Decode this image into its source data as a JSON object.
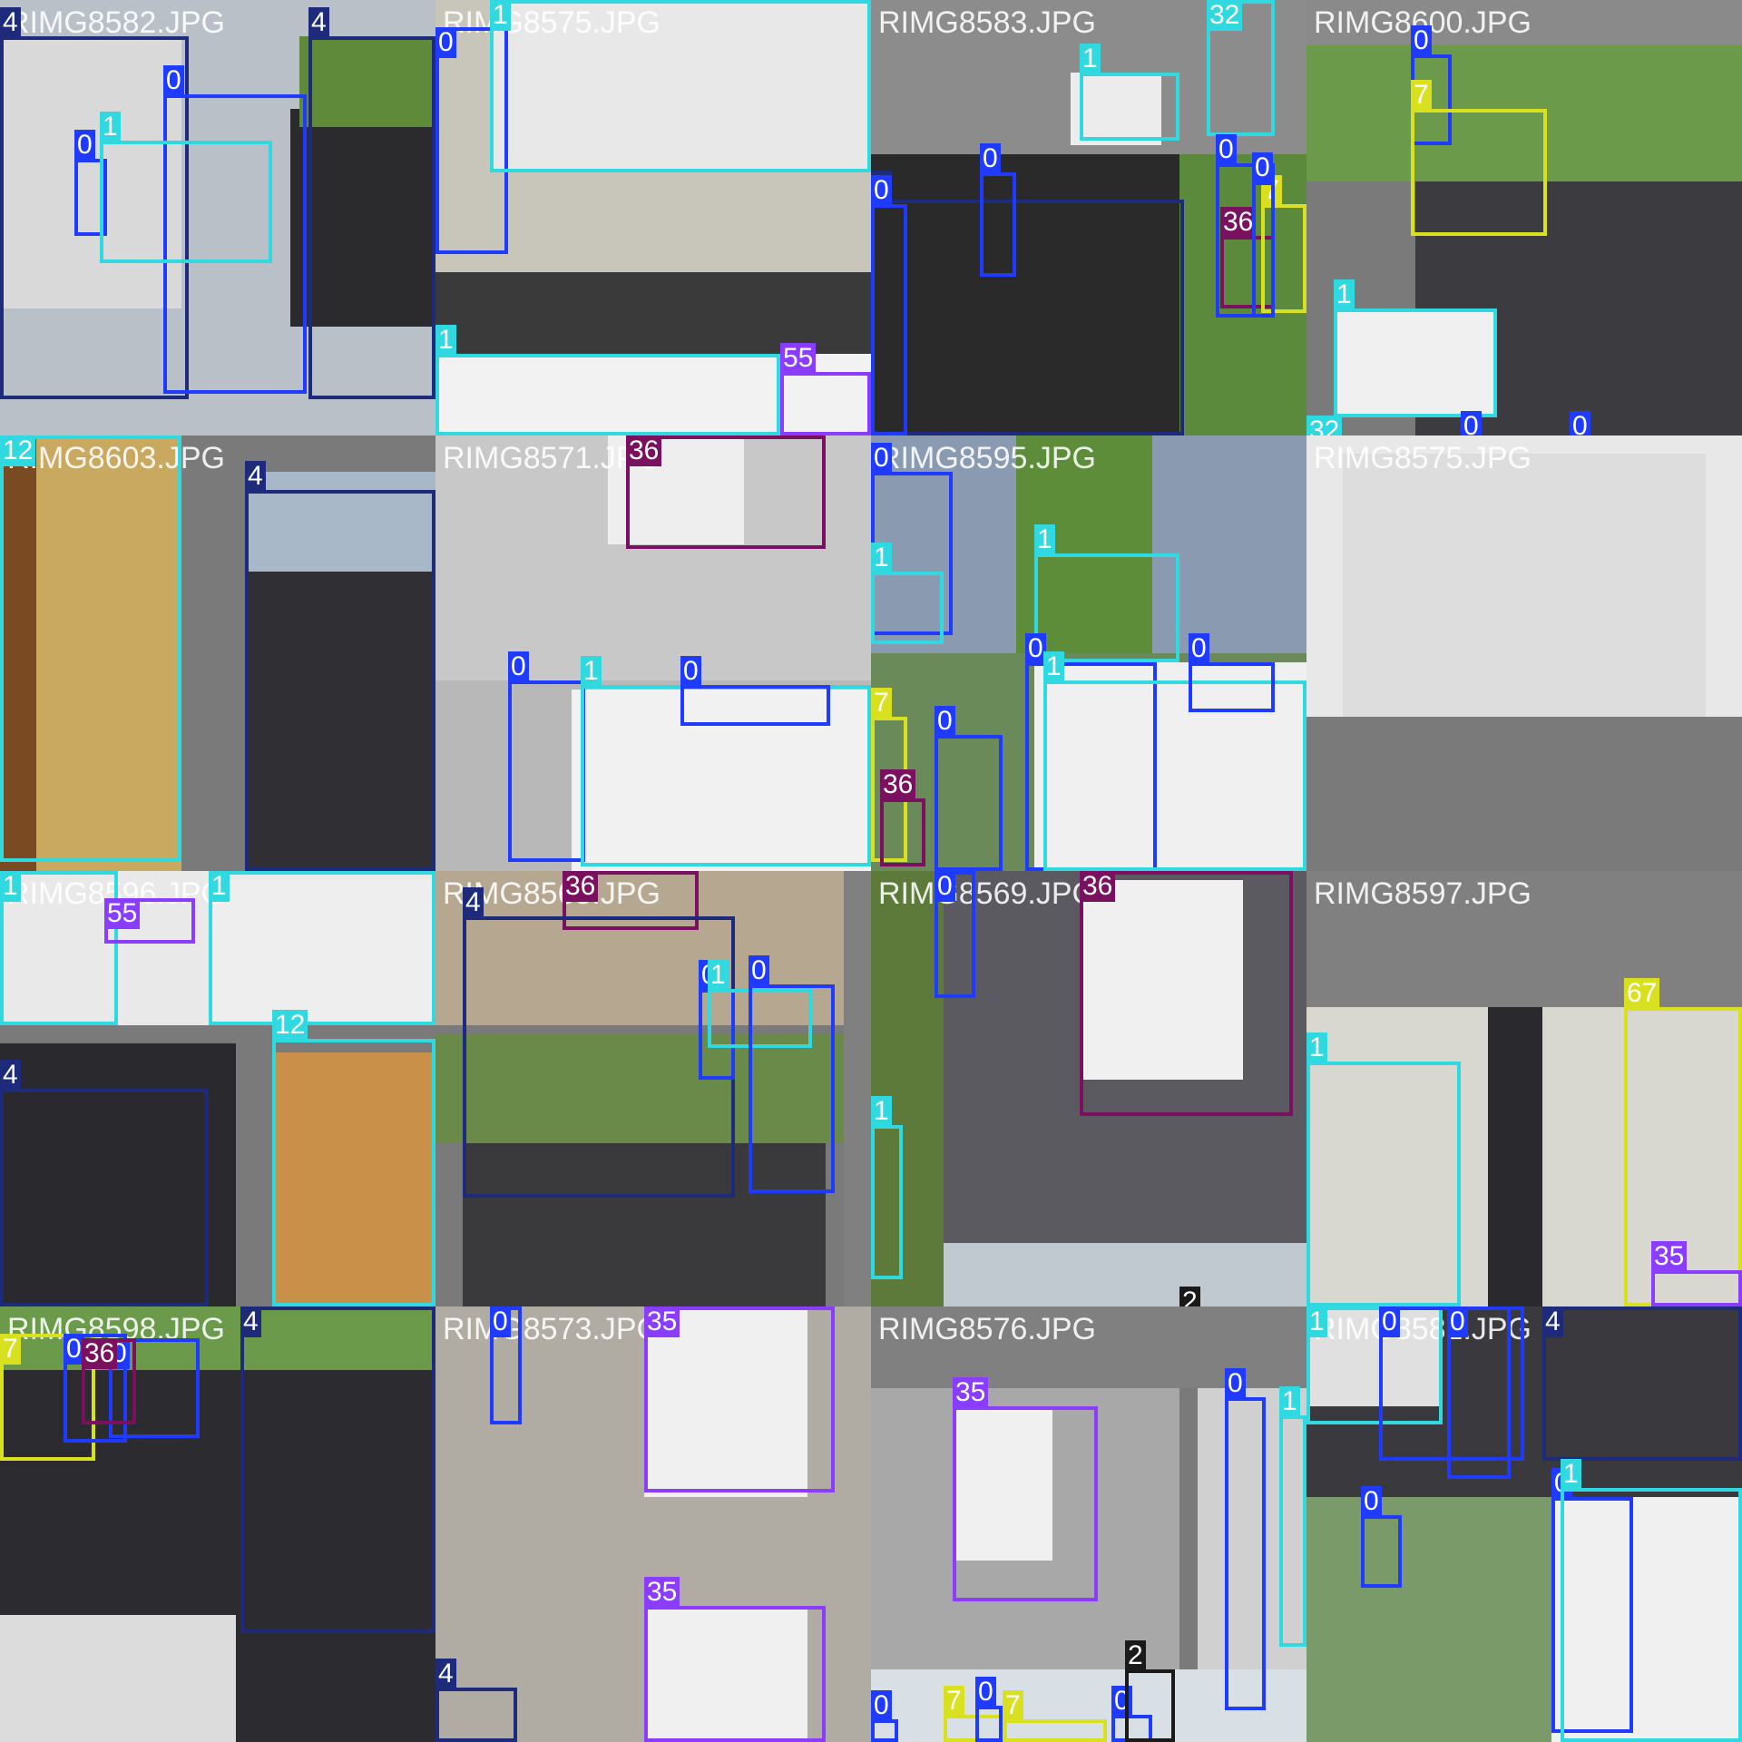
{
  "mosaic": {
    "class_colors": {
      "0": "#1f3bff",
      "1": "#30d8e0",
      "2": "#1a1a1a",
      "4": "#1e2a7a",
      "7": "#d8e020",
      "12": "#30d8e0",
      "32": "#30d8e0",
      "35": "#8a3cff",
      "36": "#7a1060",
      "55": "#8a3cff",
      "67": "#d8e020"
    },
    "tiles": [
      {
        "id": "t0",
        "label": "RIMG8582.JPG"
      },
      {
        "id": "t1",
        "label": "RIMG8575.JPG"
      },
      {
        "id": "t2",
        "label": "RIMG8583.JPG"
      },
      {
        "id": "t3",
        "label": "RIMG8600.JPG"
      },
      {
        "id": "t4",
        "label": "RIMG8603.JPG"
      },
      {
        "id": "t5",
        "label": "RIMG8571.JPG"
      },
      {
        "id": "t6",
        "label": "RIMG8595.JPG"
      },
      {
        "id": "t7",
        "label": "RIMG8575.JPG"
      },
      {
        "id": "t8",
        "label": "RIMG8596.JPG"
      },
      {
        "id": "t9",
        "label": "RIMG8565.JPG"
      },
      {
        "id": "t10",
        "label": "RIMG8569.JPG"
      },
      {
        "id": "t11",
        "label": "RIMG8597.JPG"
      },
      {
        "id": "t12",
        "label": "RIMG8598.JPG"
      },
      {
        "id": "t13",
        "label": "RIMG8573.JPG"
      },
      {
        "id": "t14",
        "label": "RIMG8576.JPG"
      },
      {
        "id": "t15",
        "label": "RIMG8582.JPG"
      }
    ],
    "detections": [
      {
        "cls": "4"
      },
      {
        "cls": "4"
      },
      {
        "cls": "0"
      },
      {
        "cls": "0"
      },
      {
        "cls": "1"
      },
      {
        "cls": "0"
      },
      {
        "cls": "1"
      },
      {
        "cls": "1"
      },
      {
        "cls": "55"
      },
      {
        "cls": "1"
      },
      {
        "cls": "32"
      },
      {
        "cls": "4"
      },
      {
        "cls": "0"
      },
      {
        "cls": "0"
      },
      {
        "cls": "36"
      },
      {
        "cls": "7"
      },
      {
        "cls": "0"
      },
      {
        "cls": "0"
      },
      {
        "cls": "0"
      },
      {
        "cls": "7"
      },
      {
        "cls": "1"
      },
      {
        "cls": "32"
      },
      {
        "cls": "0"
      },
      {
        "cls": "0"
      },
      {
        "cls": "12"
      },
      {
        "cls": "4"
      },
      {
        "cls": "36"
      },
      {
        "cls": "0"
      },
      {
        "cls": "1"
      },
      {
        "cls": "0"
      },
      {
        "cls": "0"
      },
      {
        "cls": "1"
      },
      {
        "cls": "1"
      },
      {
        "cls": "0"
      },
      {
        "cls": "1"
      },
      {
        "cls": "7"
      },
      {
        "cls": "0"
      },
      {
        "cls": "36"
      },
      {
        "cls": "0"
      },
      {
        "cls": "1"
      },
      {
        "cls": "55"
      },
      {
        "cls": "1"
      },
      {
        "cls": "12"
      },
      {
        "cls": "4"
      },
      {
        "cls": "36"
      },
      {
        "cls": "4"
      },
      {
        "cls": "0"
      },
      {
        "cls": "1"
      },
      {
        "cls": "0"
      },
      {
        "cls": "0"
      },
      {
        "cls": "36"
      },
      {
        "cls": "1"
      },
      {
        "cls": "2"
      },
      {
        "cls": "67"
      },
      {
        "cls": "1"
      },
      {
        "cls": "35"
      },
      {
        "cls": "7"
      },
      {
        "cls": "0"
      },
      {
        "cls": "0"
      },
      {
        "cls": "36"
      },
      {
        "cls": "4"
      },
      {
        "cls": "0"
      },
      {
        "cls": "35"
      },
      {
        "cls": "35"
      },
      {
        "cls": "4"
      },
      {
        "cls": "35"
      },
      {
        "cls": "0"
      },
      {
        "cls": "1"
      },
      {
        "cls": "7"
      },
      {
        "cls": "0"
      },
      {
        "cls": "7"
      },
      {
        "cls": "0"
      },
      {
        "cls": "0"
      },
      {
        "cls": "2"
      },
      {
        "cls": "1"
      },
      {
        "cls": "0"
      },
      {
        "cls": "0"
      },
      {
        "cls": "4"
      },
      {
        "cls": "0"
      },
      {
        "cls": "0"
      },
      {
        "cls": "1"
      }
    ]
  }
}
